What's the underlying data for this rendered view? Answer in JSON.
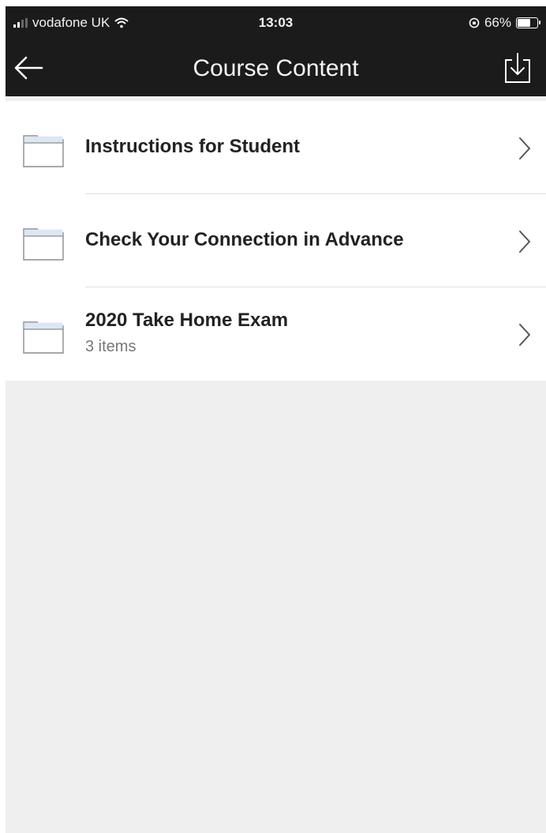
{
  "status_bar": {
    "carrier": "vodafone UK",
    "time": "13:03",
    "battery": "66%"
  },
  "header": {
    "title": "Course Content"
  },
  "items": [
    {
      "label": "Instructions for Student",
      "subtitle": ""
    },
    {
      "label": "Check Your Connection in Advance",
      "subtitle": ""
    },
    {
      "label": "2020 Take Home Exam",
      "subtitle": "3 items"
    }
  ],
  "colors": {
    "header_bg": "#1b1b1b",
    "background": "#efefef",
    "folder_tab": "#dbe7f5"
  }
}
